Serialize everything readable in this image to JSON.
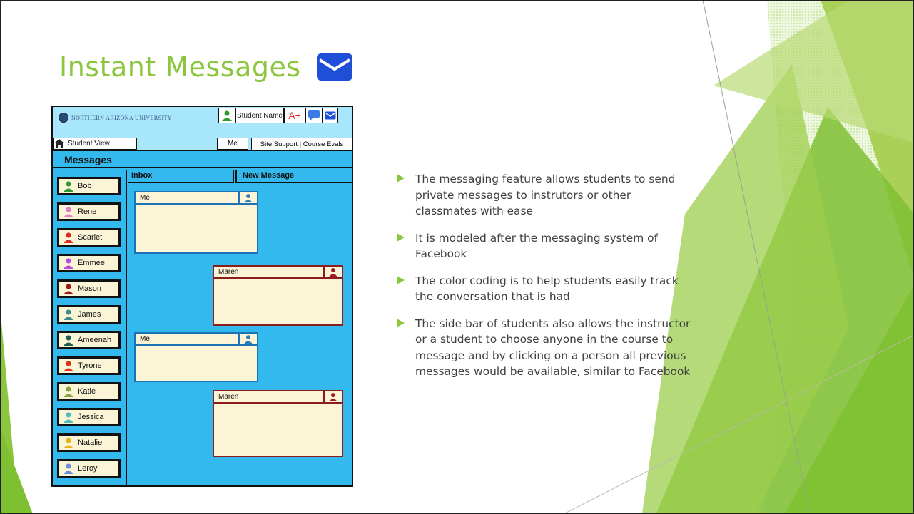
{
  "slide": {
    "title": "Instant Messages",
    "title_icon": "envelope-icon",
    "accent_color": "#8cc63e",
    "bullet_color": "#8cc63e"
  },
  "mockup": {
    "university_name": "NORTHERN ARIZONA UNIVERSITY",
    "topbar": {
      "student_name": "Student Name",
      "grade_label": "A+",
      "icons": [
        "student-avatar-icon",
        "chat-icon",
        "mail-icon"
      ]
    },
    "student_view_label": "Student View",
    "me_label": "Me",
    "links_label": "Site Support | Course Evals",
    "messages_heading": "Messages",
    "tabs": {
      "inbox": "Inbox",
      "new_message": "New Message"
    },
    "students": [
      {
        "name": "Bob",
        "color": "#2f9a2f"
      },
      {
        "name": "Rene",
        "color": "#e27ac9"
      },
      {
        "name": "Scarlet",
        "color": "#e02b1c"
      },
      {
        "name": "Emmee",
        "color": "#b84bd8"
      },
      {
        "name": "Mason",
        "color": "#9a1b1b"
      },
      {
        "name": "James",
        "color": "#3c8a8a"
      },
      {
        "name": "Ameenah",
        "color": "#1b5e52"
      },
      {
        "name": "Tyrone",
        "color": "#e0301c"
      },
      {
        "name": "Katie",
        "color": "#8aa33c"
      },
      {
        "name": "Jessica",
        "color": "#4cc3b8"
      },
      {
        "name": "Natalie",
        "color": "#e8b21c"
      },
      {
        "name": "Leroy",
        "color": "#6b8fd8"
      }
    ],
    "messages": [
      {
        "sender": "Me",
        "avatar_color": "#2a7fb8"
      },
      {
        "sender": "Maren",
        "avatar_color": "#a01d1d"
      },
      {
        "sender": "Me",
        "avatar_color": "#2a7fb8"
      },
      {
        "sender": "Maren",
        "avatar_color": "#a01d1d"
      }
    ]
  },
  "bullets": [
    "The messaging feature allows students to send private messages to instrutors or other classmates with ease",
    "It is modeled after the messaging system of Facebook",
    "The color coding is to help students easily track the conversation that is had",
    "The side bar of students also allows the instructor or a student to choose anyone in the course to message and by clicking on a person all previous messages would be available, similar to Facebook"
  ]
}
